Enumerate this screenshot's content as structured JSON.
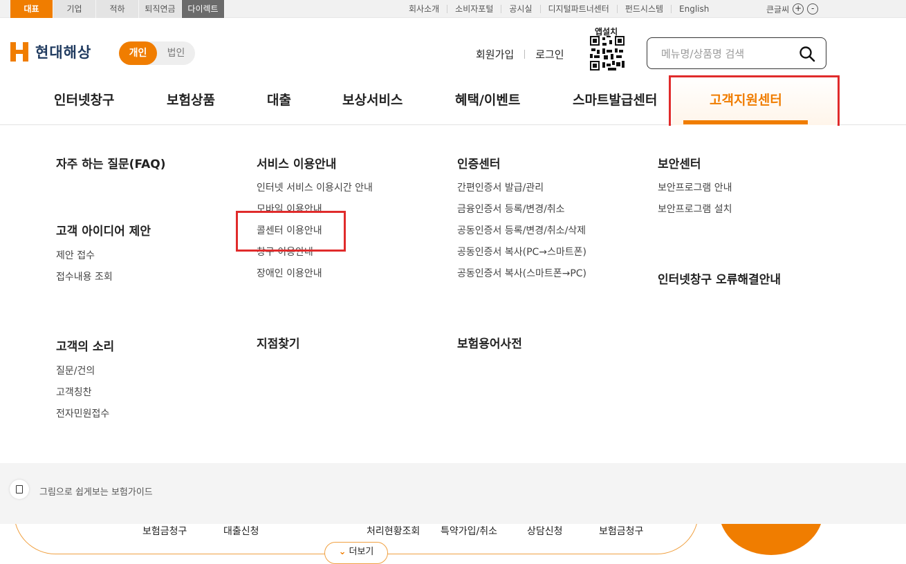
{
  "topbar": {
    "brand_tabs": [
      "대표",
      "기업",
      "적하",
      "퇴직연금",
      "다이렉트"
    ],
    "util_links": [
      "회사소개",
      "소비자포털",
      "공시실",
      "디지털파트너센터",
      "펀드시스템",
      "English"
    ],
    "font_size_label": "큰글씨",
    "font_up": "+",
    "font_down": "-"
  },
  "header": {
    "logo_text": "현대해상",
    "toggle": {
      "on": "개인",
      "off": "법인"
    },
    "signup": "회원가입",
    "login": "로그인",
    "app_install": "앱설치",
    "search_placeholder": "메뉴명/상품명 검색"
  },
  "gnb": {
    "items": [
      "인터넷창구",
      "보험상품",
      "대출",
      "보상서비스",
      "혜택/이벤트",
      "스마트발급센터",
      "고객지원센터"
    ],
    "active": "고객지원센터"
  },
  "mega": {
    "faq": {
      "title": "자주 하는 질문(FAQ)"
    },
    "idea": {
      "title": "고객 아이디어 제안",
      "links": [
        "제안 접수",
        "접수내용 조회"
      ]
    },
    "voice": {
      "title": "고객의 소리",
      "links": [
        "질문/건의",
        "고객칭찬",
        "전자민원접수"
      ]
    },
    "service": {
      "title": "서비스 이용안내",
      "links": [
        "인터넷 서비스 이용시간 안내",
        "모바일 이용안내",
        "콜센터 이용안내",
        "창구 이용안내",
        "장애인 이용안내"
      ]
    },
    "branch": {
      "title": "지점찾기"
    },
    "cert": {
      "title": "인증센터",
      "links": [
        "간편인증서 발급/관리",
        "금융인증서 등록/변경/취소",
        "공동인증서 등록/변경/취소/삭제",
        "공동인증서 복사(PC→스마트폰)",
        "공동인증서 복사(스마트폰→PC)"
      ]
    },
    "dict": {
      "title": "보험용어사전"
    },
    "security": {
      "title": "보안센터",
      "links": [
        "보안프로그램 안내",
        "보안프로그램 설치"
      ]
    },
    "error": {
      "title": "인터넷창구 오류해결안내"
    }
  },
  "guide": {
    "text": "그림으로 쉽게보는 보험가이드"
  },
  "quick": {
    "items": [
      "보험금청구",
      "대출신청",
      "처리현황조회",
      "특약가입/취소",
      "상담신청",
      "보험금청구"
    ],
    "more": "더보기"
  },
  "colors": {
    "accent": "#f07d00",
    "highlight": "#e02b2b",
    "navy": "#1f3a5f"
  }
}
